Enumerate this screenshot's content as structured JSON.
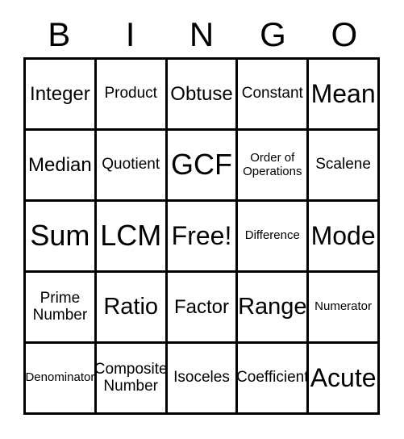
{
  "card": {
    "title": "BINGO",
    "background_color": "#ffffff",
    "line_color": "#000000",
    "text_color": "#000000"
  },
  "header": {
    "letters": [
      "B",
      "I",
      "N",
      "G",
      "O"
    ]
  },
  "grid": {
    "rows": 5,
    "columns": 5,
    "cells": [
      {
        "text": "Integer",
        "size": "md"
      },
      {
        "text": "Product",
        "size": "sm"
      },
      {
        "text": "Obtuse",
        "size": "md"
      },
      {
        "text": "Constant",
        "size": "sm"
      },
      {
        "text": "Mean",
        "size": "xl"
      },
      {
        "text": "Median",
        "size": "md"
      },
      {
        "text": "Quotient",
        "size": "sm"
      },
      {
        "text": "GCF",
        "size": "xxl"
      },
      {
        "text": "Order of\nOperations",
        "size": "xs"
      },
      {
        "text": "Scalene",
        "size": "sm"
      },
      {
        "text": "Sum",
        "size": "xxl"
      },
      {
        "text": "LCM",
        "size": "xxl"
      },
      {
        "text": "Free!",
        "size": "xl"
      },
      {
        "text": "Difference",
        "size": "xs"
      },
      {
        "text": "Mode",
        "size": "xl"
      },
      {
        "text": "Prime\nNumber",
        "size": "sm"
      },
      {
        "text": "Ratio",
        "size": "lg"
      },
      {
        "text": "Factor",
        "size": "md"
      },
      {
        "text": "Range",
        "size": "lg"
      },
      {
        "text": "Numerator",
        "size": "xs"
      },
      {
        "text": "Denominator",
        "size": "xs"
      },
      {
        "text": "Composite\nNumber",
        "size": "sm"
      },
      {
        "text": "Isoceles",
        "size": "sm"
      },
      {
        "text": "Coefficient",
        "size": "sm"
      },
      {
        "text": "Acute",
        "size": "xl"
      }
    ]
  }
}
